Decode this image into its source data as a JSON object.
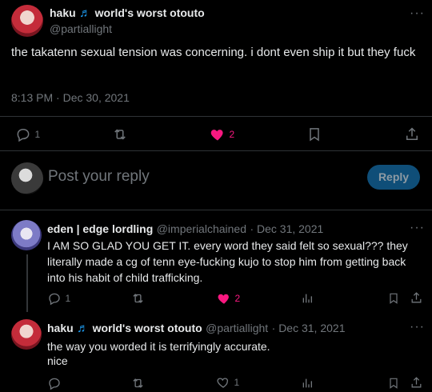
{
  "main_tweet": {
    "display_name": "haku",
    "display_name_suffix": "world's worst otouto",
    "handle": "@partiallight",
    "text": "the takatenn sexual tension was concerning. i dont even ship it but they fuck",
    "timestamp": "8:13 PM · Dec 30, 2021",
    "replies": "1",
    "likes": "2"
  },
  "reply_box": {
    "placeholder": "Post your reply",
    "button_label": "Reply"
  },
  "replies": [
    {
      "display_name": "eden | edge lordling",
      "handle": "@imperialchained",
      "date": "· Dec 31, 2021",
      "text": "I AM SO GLAD YOU GET IT. every word they said felt so sexual??? they literally made a cg of tenn eye-fucking kujo to stop him from getting back into his habit of child trafficking.",
      "replies": "1",
      "likes": "2"
    },
    {
      "display_name": "haku",
      "display_name_suffix": "world's worst otouto",
      "handle": "@partiallight",
      "date": "· Dec 31, 2021",
      "text_line1": "the way you worded it is terrifyingly accurate.",
      "text_line2": "nice",
      "likes": "1"
    }
  ],
  "colors": {
    "background": "#000000",
    "text": "#e7e9ea",
    "muted": "#71767b",
    "like": "#f91880",
    "accent": "#1d9bf0",
    "reply_button": "#1d9bf0"
  }
}
